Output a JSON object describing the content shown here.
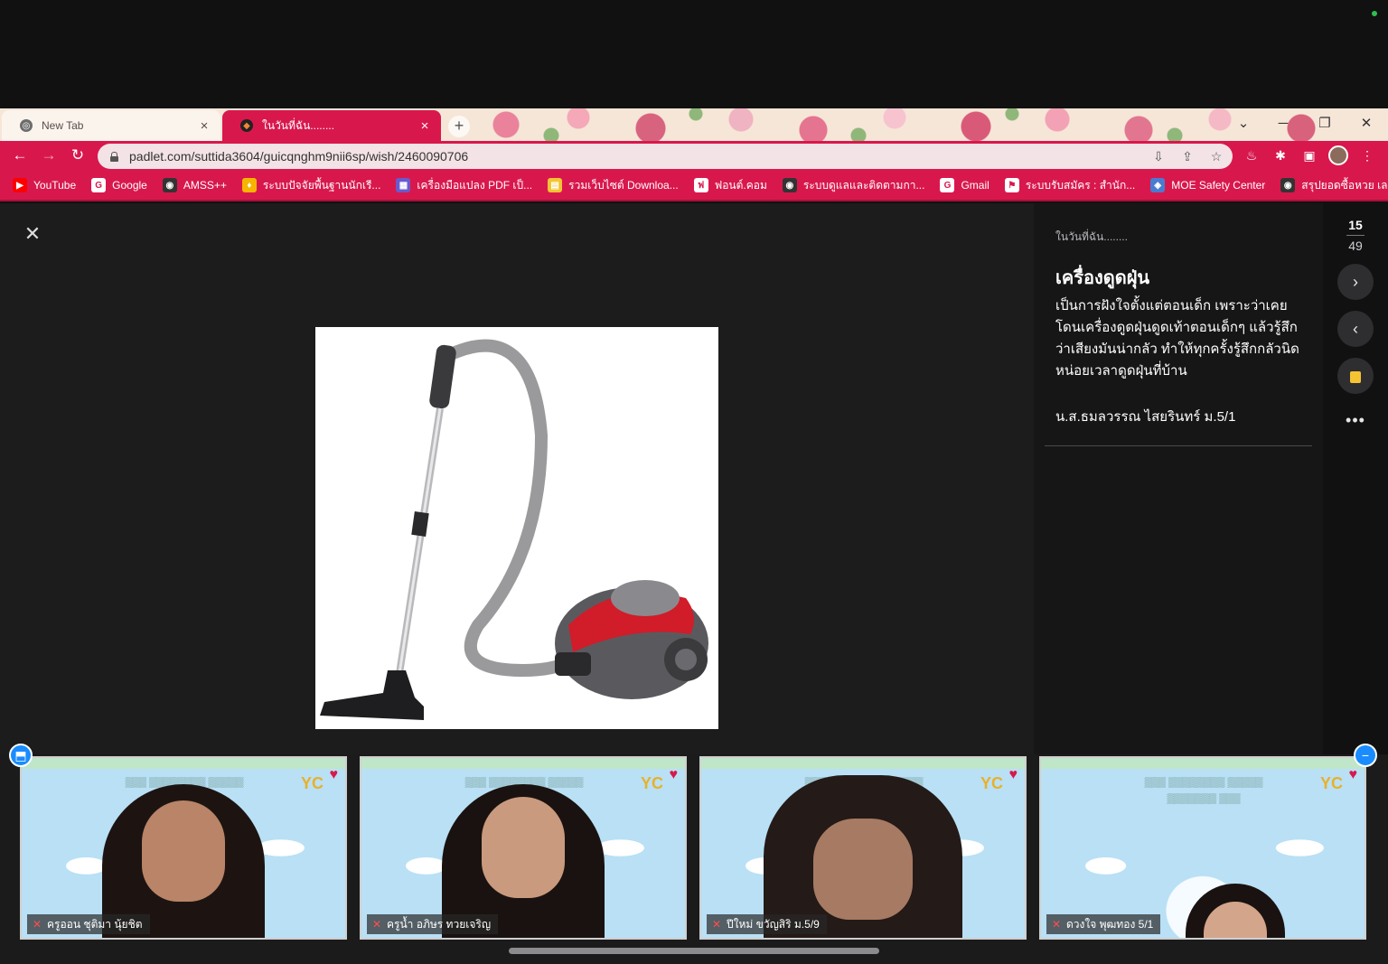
{
  "browser": {
    "tabs": [
      {
        "label": "New Tab",
        "active": false
      },
      {
        "label": "ในวันที่ฉัน........",
        "active": true
      }
    ],
    "new_tab_symbol": "+",
    "url": "padlet.com/suttida3604/guicqnghm9nii6sp/wish/2460090706",
    "bookmarks": [
      {
        "label": "YouTube",
        "icon": "youtube-icon",
        "color": "#ff0000"
      },
      {
        "label": "Google",
        "icon": "google-icon",
        "color": "#ffffff"
      },
      {
        "label": "AMSS++",
        "icon": "globe-icon",
        "color": "#333333"
      },
      {
        "label": "ระบบปัจจัยพื้นฐานนักเรี...",
        "icon": "flame-icon",
        "color": "#f7b500"
      },
      {
        "label": "เครื่องมือแปลง PDF เป็...",
        "icon": "pdf-tool-icon",
        "color": "#6a5acd"
      },
      {
        "label": "รวมเว็บไซต์ Downloa...",
        "icon": "download-site-icon",
        "color": "#f5c432"
      },
      {
        "label": "ฟอนต์.คอม",
        "icon": "font-icon",
        "color": "#ffffff"
      },
      {
        "label": "ระบบดูแลและติดตามกา...",
        "icon": "globe-icon",
        "color": "#333333"
      },
      {
        "label": "Gmail",
        "icon": "google-icon",
        "color": "#ffffff"
      },
      {
        "label": "ระบบรับสมัคร : สำนัก...",
        "icon": "flag-icon",
        "color": "#ffffff"
      },
      {
        "label": "MOE Safety Center",
        "icon": "shield-icon",
        "color": "#4a7bd0"
      },
      {
        "label": "สรุปยอดซื้อหวย เลขวั...",
        "icon": "globe-icon",
        "color": "#333333"
      }
    ]
  },
  "post": {
    "wall_title": "ในวันที่ฉัน........",
    "title": "เครื่องดูดฝุ่น",
    "body": "เป็นการฝังใจตั้งแต่ตอนเด็ก เพราะว่าเคยโดนเครื่องดูดฝุ่นดูดเท้าตอนเด็กๆ แล้วรู้สึกว่าเสียงมันน่ากลัว ทำให้ทุกครั้งรู้สึกกลัวนิดหน่อยเวลาดูดฝุ่นที่บ้าน",
    "author": "น.ส.ธมลวรรณ ไสยรินทร์ ม.5/1",
    "attachment_icon": "vacuum-cleaner-image"
  },
  "pager": {
    "current": "15",
    "total": "49"
  },
  "participants": [
    {
      "name": "ครูออน ชุติมา นุ้ยชิต",
      "muted": true
    },
    {
      "name": "ครูน้ำ อภิษร ทวยเจริญ",
      "muted": true
    },
    {
      "name": "ปีใหม่ ขวัญสิริ ม.5/9",
      "muted": true
    },
    {
      "name": "ดวงใจ พุฒทอง 5/1",
      "muted": true
    }
  ],
  "colors": {
    "browser_theme": "#d8184d",
    "viewer_bg": "#1c1c1d",
    "accent_blue": "#1a8cff"
  }
}
